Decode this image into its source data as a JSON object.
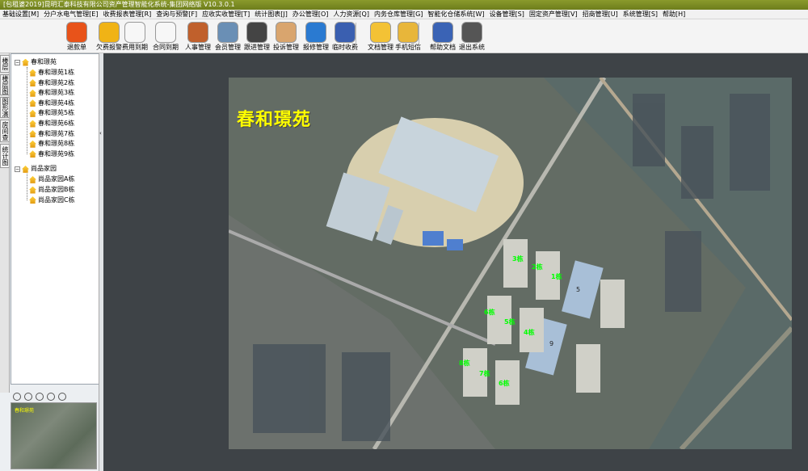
{
  "window": {
    "title": "[包租婆2019]昆明汇泰科技有限公司资产管理智能化系统-集团网络版 V10.3.0.1"
  },
  "menu": {
    "items": [
      "基础设置[M]",
      "分户水电气管理[E]",
      "收费报表管理[R]",
      "查询与预警[F]",
      "应收实收管理[T]",
      "统计图表[J]",
      "办公管理[O]",
      "人力资源[Q]",
      "内务仓库管理[G]",
      "智能化仓储系统[W]",
      "设备管理[S]",
      "固定资产管理[V]",
      "招商管理[U]",
      "系统管理[S]",
      "帮助[H]"
    ]
  },
  "toolbar": {
    "buttons": [
      {
        "label": "退款单",
        "icon": "refund-icon",
        "color": "#e8531a"
      },
      {
        "label": "欠费报警",
        "icon": "bell-icon",
        "color": "#f0b316"
      },
      {
        "label": "费用到期",
        "icon": "clock-icon",
        "color": "#f7f7f7"
      },
      {
        "label": "合同到期",
        "icon": "alarm-clock-icon",
        "color": "#f7f7f7"
      },
      {
        "label": "人事管理",
        "icon": "people-icon",
        "color": "#c0602c"
      },
      {
        "label": "会员管理",
        "icon": "member-card-icon",
        "color": "#6a8fb5"
      },
      {
        "label": "跟进管理",
        "icon": "follow-up-icon",
        "color": "#444"
      },
      {
        "label": "投诉管理",
        "icon": "complaint-icon",
        "color": "#d9a56e"
      },
      {
        "label": "报修管理",
        "icon": "repair-icon",
        "color": "#2a7ad1"
      },
      {
        "label": "临时收费",
        "icon": "temp-fee-icon",
        "color": "#3a5fb0"
      },
      {
        "label": "文档管理",
        "icon": "folder-icon",
        "color": "#f3c235"
      },
      {
        "label": "手机短信",
        "icon": "sms-icon",
        "color": "#e8b63a"
      },
      {
        "label": "帮助文档",
        "icon": "help-book-icon",
        "color": "#3a63b5"
      },
      {
        "label": "退出系统",
        "icon": "power-icon",
        "color": "#555"
      }
    ]
  },
  "sidetabs": [
    "楼层平面",
    "楼层图示",
    "图形演示",
    "房间查询",
    "统计图表"
  ],
  "tree": {
    "groups": [
      {
        "label": "春和璟苑",
        "items": [
          "春和璟苑1栋",
          "春和璟苑2栋",
          "春和璟苑3栋",
          "春和璟苑4栋",
          "春和璟苑5栋",
          "春和璟苑6栋",
          "春和璟苑7栋",
          "春和璟苑8栋",
          "春和璟苑9栋"
        ]
      },
      {
        "label": "尚品家园",
        "items": [
          "尚品家园A栋",
          "尚品家园B栋",
          "尚品家园C栋"
        ]
      }
    ]
  },
  "minimap": {
    "title": "春和璟苑"
  },
  "map": {
    "title": "春和璟苑",
    "labels": [
      "3栋",
      "2栋",
      "1栋",
      "6栋",
      "5栋",
      "4栋",
      "8栋",
      "7栋",
      "6栋"
    ],
    "roofs": [
      "5",
      "9"
    ]
  }
}
